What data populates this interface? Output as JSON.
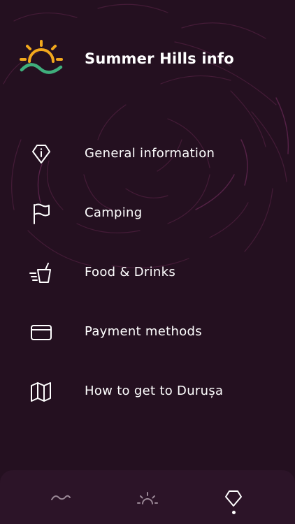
{
  "header": {
    "title": "Summer Hills info",
    "logo_icon": "sun-hills-logo",
    "logo_colors": {
      "sun": "#f2a81d",
      "hills": "#3fae7c"
    }
  },
  "menu": {
    "items": [
      {
        "label": "General information",
        "icon": "info-pentagon-icon"
      },
      {
        "label": "Camping",
        "icon": "flag-icon"
      },
      {
        "label": "Food & Drinks",
        "icon": "drink-cup-icon"
      },
      {
        "label": "Payment methods",
        "icon": "credit-card-icon"
      },
      {
        "label": "How to get to Durușa",
        "icon": "map-icon"
      }
    ]
  },
  "tabbar": {
    "tabs": [
      {
        "icon": "wave-icon",
        "active": false
      },
      {
        "icon": "sunrise-icon",
        "active": false
      },
      {
        "icon": "pentagon-pin-icon",
        "active": true
      }
    ]
  },
  "colors": {
    "background": "#241020",
    "tabbar": "#2c1428",
    "swirl": "#5a2448",
    "text": "#ffffff"
  }
}
